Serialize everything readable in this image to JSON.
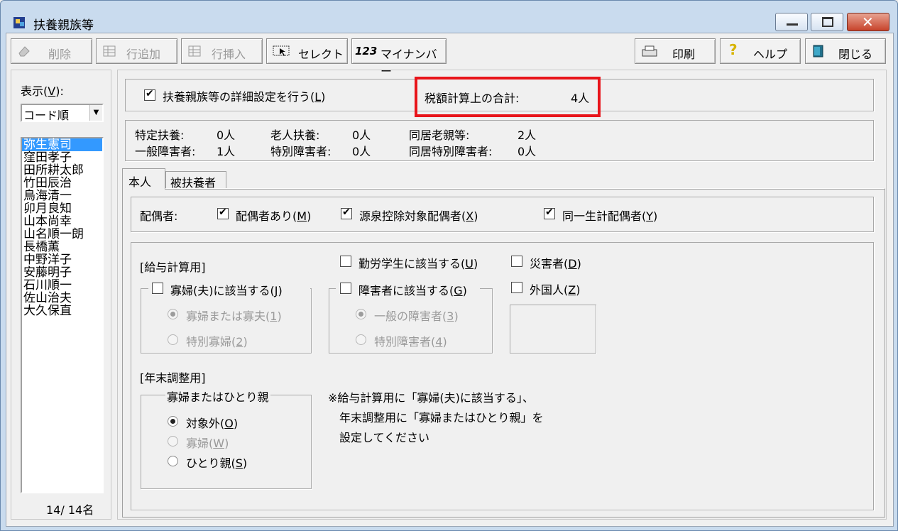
{
  "window": {
    "title": "扶養親族等"
  },
  "toolbar": {
    "delete": "削除",
    "add_row": "行追加",
    "insert_row": "行挿入",
    "select": "セレクト",
    "mynumber_prefix": "123",
    "mynumber": "マイナンバー",
    "print": "印刷",
    "help": "ヘルプ",
    "close": "閉じる"
  },
  "sidebar": {
    "display_label": "表示(V):",
    "sort_value": "コード順",
    "names": [
      "弥生憲司",
      "窪田孝子",
      "田所耕太郎",
      "竹田辰治",
      "鳥海清一",
      "卯月良知",
      "山本尚幸",
      "山名順一朗",
      "長橋薫",
      "中野洋子",
      "安藤明子",
      "石川順一",
      "佐山治夫",
      "大久保直"
    ],
    "selected_index": 0,
    "count": "14/ 14名"
  },
  "header": {
    "detail_setting_label": "扶養親族等の詳細設定を行う(L)",
    "detail_setting_checked": true,
    "tax_total_label": "税額計算上の合計:",
    "tax_total_value": "4人"
  },
  "summary": {
    "r1": [
      {
        "label": "特定扶養:",
        "value": "0人"
      },
      {
        "label": "老人扶養:",
        "value": "0人"
      },
      {
        "label": "同居老親等:",
        "value": "2人"
      }
    ],
    "r2": [
      {
        "label": "一般障害者:",
        "value": "1人"
      },
      {
        "label": "特別障害者:",
        "value": "0人"
      },
      {
        "label": "同居特別障害者:",
        "value": "0人"
      }
    ]
  },
  "tabs": [
    "本人",
    "被扶養者"
  ],
  "spouse": {
    "label": "配偶者:",
    "has_spouse": "配偶者あり(M)",
    "withholding": "源泉控除対象配偶者(X)",
    "same_household": "同一生計配偶者(Y)"
  },
  "salary": {
    "section": "[給与計算用]",
    "widow_group": "寡婦(夫)に該当する(J)",
    "widow_opt1": "寡婦または寡夫(1)",
    "widow_opt2": "特別寡婦(2)",
    "student": "勤労学生に該当する(U)",
    "disabled_group": "障害者に該当する(G)",
    "disabled_opt1": "一般の障害者(3)",
    "disabled_opt2": "特別障害者(4)",
    "disaster": "災害者(D)",
    "foreigner": "外国人(Z)"
  },
  "yearend": {
    "section": "[年末調整用]",
    "group": "寡婦またはひとり親",
    "opt_none": "対象外(O)",
    "opt_widow": "寡婦(W)",
    "opt_single": "ひとり親(S)",
    "note1": "※給与計算用に「寡婦(夫)に該当する」、",
    "note2": "年末調整用に「寡婦またはひとり親」を",
    "note3": "設定してください"
  },
  "colors": {
    "highlight_box": "#e8141a",
    "selection": "#3399ff"
  }
}
